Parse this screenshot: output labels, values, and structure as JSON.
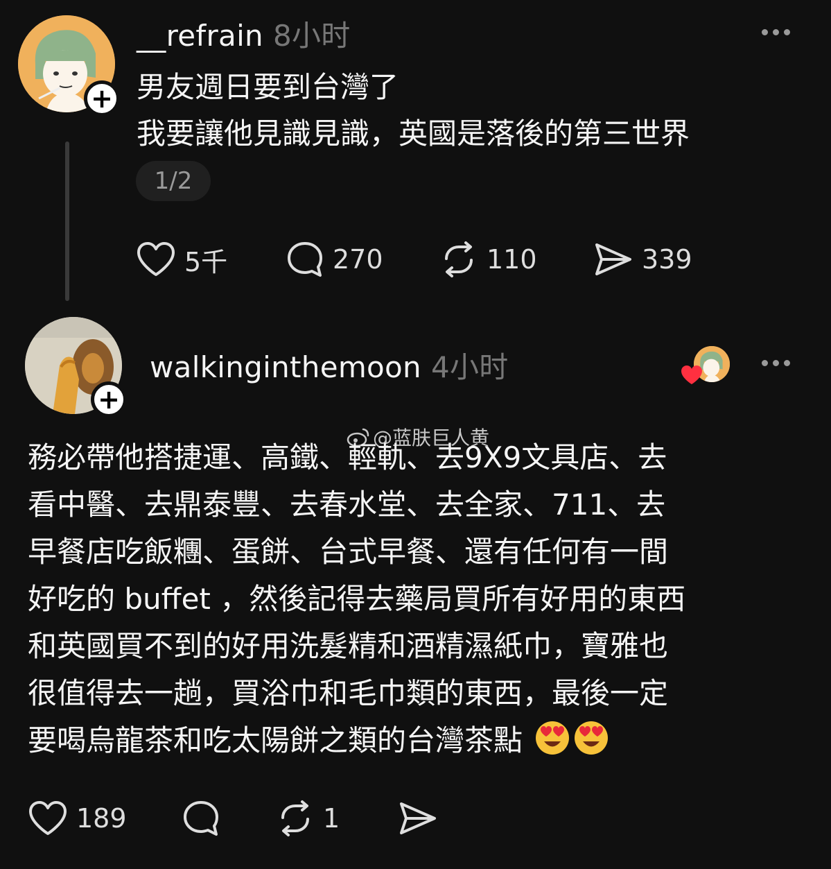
{
  "post1": {
    "username": "__refrain",
    "time": "8小时",
    "line1": "男友週日要到台灣了",
    "line2": "我要讓他見識見識，英國是落後的第三世界",
    "pager": "1/2",
    "likes": "5千",
    "comments": "270",
    "reposts": "110",
    "shares": "339"
  },
  "post2": {
    "username": "walkinginthemoon",
    "time": "4小时",
    "lines": [
      "務必帶他搭捷運、高鐵、輕軌、去9X9文具店、去",
      "看中醫、去鼎泰豐、去春水堂、去全家、711、去",
      "早餐店吃飯糰、蛋餅、台式早餐、還有任何有一間",
      "好吃的 buffet ，然後記得去藥局買所有好用的東西",
      "和英國買不到的好用洗髮精和酒精濕紙巾，寶雅也",
      "很值得去一趟，買浴巾和毛巾類的東西，最後一定",
      "要喝烏龍茶和吃太陽餅之類的台灣茶點"
    ],
    "likes": "189",
    "comments": "",
    "reposts": "1",
    "shares": ""
  },
  "watermark": "@蓝肤巨人黄",
  "icons": {
    "like": "heart-outline-icon",
    "comment": "speech-bubble-icon",
    "repost": "repost-arrows-icon",
    "share": "send-paper-plane-icon",
    "emoji": "heart-eyes-emoji"
  },
  "colors": {
    "background": "#101010",
    "text": "#f5f5f5",
    "muted": "#777777",
    "heart_badge": "#ff3040"
  }
}
